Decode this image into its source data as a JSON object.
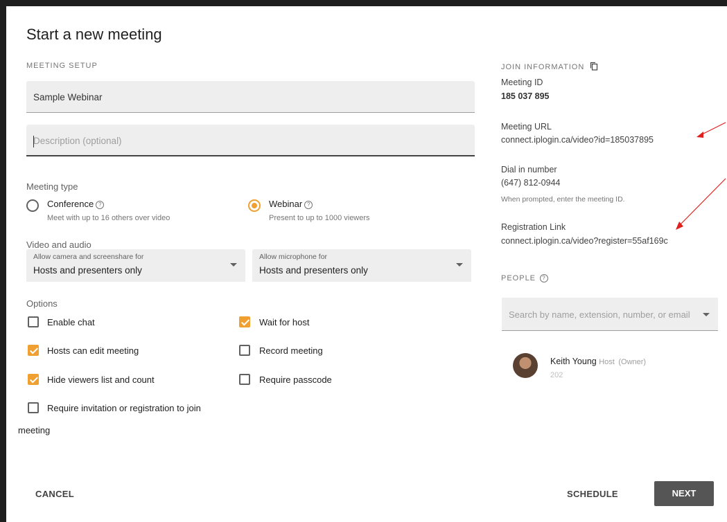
{
  "dialog": {
    "title": "Start a new meeting"
  },
  "setup": {
    "section_label": "MEETING SETUP",
    "name_value": "Sample Webinar",
    "description_placeholder": "Description (optional)"
  },
  "meeting_type": {
    "label": "Meeting type",
    "options": [
      {
        "label": "Conference",
        "desc": "Meet with up to 16 others over video",
        "selected": false
      },
      {
        "label": "Webinar",
        "desc": "Present to up to 1000 viewers",
        "selected": true
      }
    ]
  },
  "video_audio": {
    "label": "Video and audio",
    "camera_label": "Allow camera and screenshare for",
    "camera_value": "Hosts and presenters only",
    "mic_label": "Allow microphone for",
    "mic_value": "Hosts and presenters only"
  },
  "options": {
    "label": "Options",
    "items": [
      {
        "label": "Enable chat",
        "checked": false
      },
      {
        "label": "Wait for host",
        "checked": true
      },
      {
        "label": "Hosts can edit meeting",
        "checked": true
      },
      {
        "label": "Record meeting",
        "checked": false
      },
      {
        "label": "Hide viewers list and count",
        "checked": true
      },
      {
        "label": "Require passcode",
        "checked": false
      },
      {
        "label": "Require invitation or registration to join",
        "checked": false
      }
    ],
    "wrap_text": "meeting"
  },
  "join_info": {
    "section_label": "JOIN INFORMATION",
    "meeting_id_label": "Meeting ID",
    "meeting_id_value": "185 037 895",
    "meeting_url_label": "Meeting URL",
    "meeting_url_value": "connect.iplogin.ca/video?id=185037895",
    "dial_label": "Dial in number",
    "dial_value": "(647) 812-0944",
    "dial_hint": "When prompted, enter the meeting ID.",
    "registration_label": "Registration Link",
    "registration_value": "connect.iplogin.ca/video?register=55af169c"
  },
  "people": {
    "section_label": "PEOPLE",
    "search_placeholder": "Search by name, extension, number, or email",
    "list": [
      {
        "name": "Keith Young",
        "role": "Host",
        "tag": "(Owner)",
        "extension": "202"
      }
    ]
  },
  "footer": {
    "cancel_label": "CANCEL",
    "schedule_label": "SCHEDULE",
    "next_label": "NEXT"
  },
  "colors": {
    "accent": "#f0a030",
    "annotation": "#e0201c"
  },
  "icons": {
    "copy": "copy-icon",
    "help": "help-circle-icon",
    "dropdown": "triangle-down-icon"
  }
}
